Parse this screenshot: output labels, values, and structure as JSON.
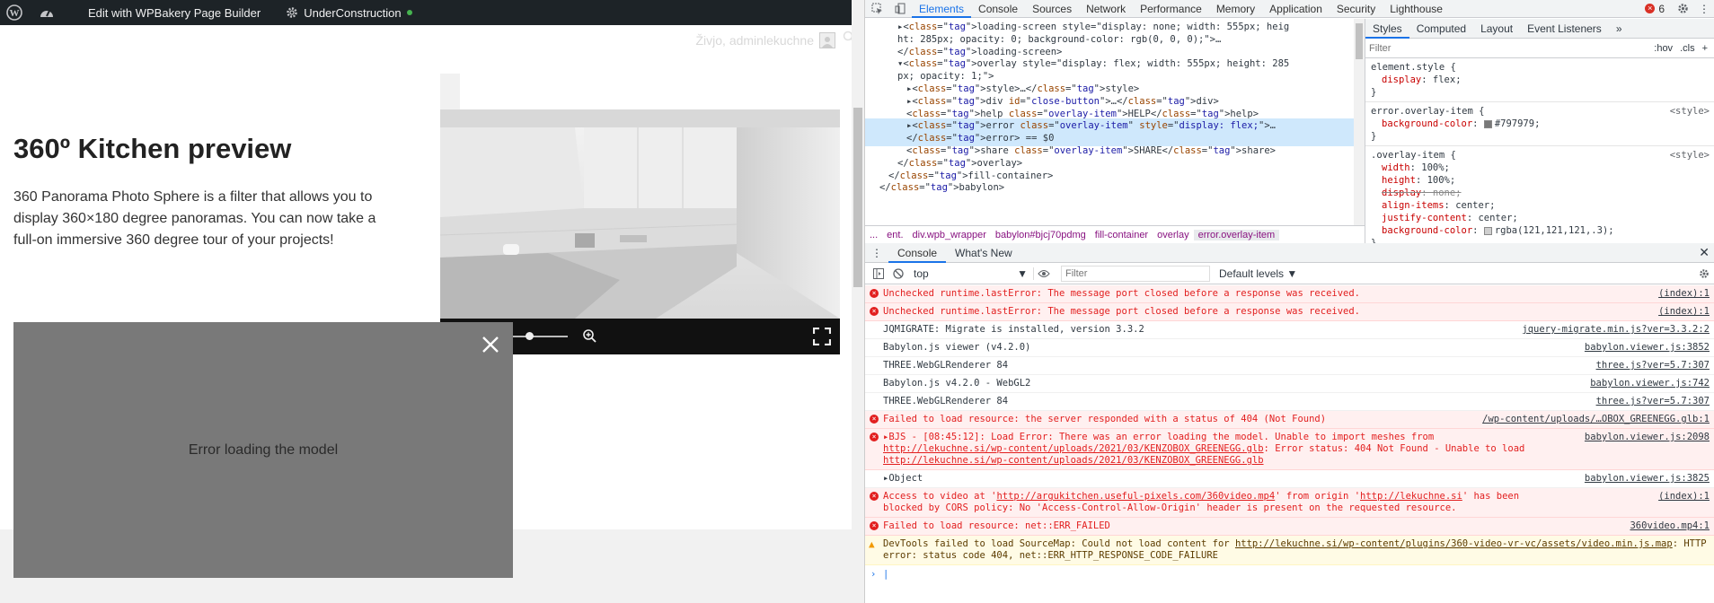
{
  "admin_bar": {
    "wpbakery_label": "Edit with WPBakery Page Builder",
    "site_status_label": "UnderConstruction",
    "status_color": "#46b450"
  },
  "header": {
    "user_greeting": "Živjo, adminlekuchne"
  },
  "hero": {
    "title": "360º Kitchen preview",
    "description": "360 Panorama Photo Sphere is a filter that allows you to display 360×180 degree panoramas. You can now take a full-on immersive 360 degree tour of your projects!"
  },
  "viewer": {
    "overlay_color": "#797979",
    "error_text": "Error loading the model"
  },
  "devtools": {
    "tabs": [
      "Elements",
      "Console",
      "Sources",
      "Network",
      "Performance",
      "Memory",
      "Application",
      "Security",
      "Lighthouse"
    ],
    "error_count": "6",
    "dom_lines": [
      {
        "indent": 1,
        "html": "▸&lt;loading-screen style=\"display: none; width: 555px; heig"
      },
      {
        "indent": 1,
        "html": "ht: 285px; opacity: 0; background-color: rgb(0, 0, 0);\"&gt;…"
      },
      {
        "indent": 1,
        "html": "&lt;/loading-screen&gt;"
      },
      {
        "indent": 1,
        "html": "▾&lt;overlay style=\"display: flex; width: 555px; height: 285"
      },
      {
        "indent": 1,
        "html": "px; opacity: 1;\"&gt;"
      },
      {
        "indent": 2,
        "html": "▸&lt;style&gt;…&lt;/style&gt;"
      },
      {
        "indent": 2,
        "html": "▸&lt;div id=\"close-button\"&gt;…&lt;/div&gt;"
      },
      {
        "indent": 2,
        "html": "&lt;help class=\"overlay-item\"&gt;HELP&lt;/help&gt;"
      },
      {
        "indent": 2,
        "html": "▸&lt;error class=\"overlay-item\" style=\"display: flex;\"&gt;…",
        "selected": true
      },
      {
        "indent": 2,
        "html": "&lt;/error&gt; == $0",
        "selected": true
      },
      {
        "indent": 2,
        "html": "&lt;share class=\"overlay-item\"&gt;SHARE&lt;/share&gt;"
      },
      {
        "indent": 1,
        "html": "&lt;/overlay&gt;"
      },
      {
        "indent": 0,
        "html": "&lt;/fill-container&gt;"
      },
      {
        "indent": -1,
        "html": "&lt;/babylon&gt;"
      }
    ],
    "breadcrumbs": [
      "...",
      "ent.",
      "div.wpb_wrapper",
      "babylon#bjcj70pdmg",
      "fill-container",
      "overlay",
      "error.overlay-item"
    ],
    "styles_tabs": [
      "Styles",
      "Computed",
      "Layout",
      "Event Listeners",
      "»"
    ],
    "styles_filter_placeholder": "Filter",
    "styles_buttons": [
      ":hov",
      ".cls",
      "+"
    ],
    "rules": [
      {
        "selector": "element.style {",
        "source": "",
        "props": [
          {
            "name": "display",
            "value": "flex;"
          }
        ]
      },
      {
        "selector": "error.overlay-item {",
        "source": "<style>",
        "props": [
          {
            "name": "background-color",
            "value": "#797979;",
            "swatch": "#797979"
          }
        ]
      },
      {
        "selector": ".overlay-item {",
        "source": "<style>",
        "props": [
          {
            "name": "width",
            "value": "100%;"
          },
          {
            "name": "height",
            "value": "100%;"
          },
          {
            "name": "display",
            "value": "none;",
            "struck": true
          },
          {
            "name": "align-items",
            "value": "center;"
          },
          {
            "name": "justify-content",
            "value": "center;"
          },
          {
            "name": "background-color",
            "value": "rgba(121,121,121,.3);",
            "swatch": "#cfcfcf"
          }
        ]
      }
    ],
    "drawer_tabs": [
      "Console",
      "What's New"
    ],
    "context": "top",
    "console_filter_placeholder": "Filter",
    "levels_label": "Default levels ▼",
    "messages": [
      {
        "level": "error",
        "text": "Unchecked runtime.lastError: The message port closed before a response was received.",
        "source": "(index):1"
      },
      {
        "level": "error",
        "text": "Unchecked runtime.lastError: The message port closed before a response was received.",
        "source": "(index):1"
      },
      {
        "level": "info",
        "text": "JQMIGRATE: Migrate is installed, version 3.3.2",
        "source": "jquery-migrate.min.js?ver=3.3.2:2"
      },
      {
        "level": "info",
        "text": "Babylon.js viewer (v4.2.0)",
        "source": "babylon.viewer.js:3852"
      },
      {
        "level": "info",
        "text": "THREE.WebGLRenderer 84",
        "source": "three.js?ver=5.7:307"
      },
      {
        "level": "info",
        "text": "Babylon.js v4.2.0 - WebGL2",
        "source": "babylon.viewer.js:742"
      },
      {
        "level": "info",
        "text": "THREE.WebGLRenderer 84",
        "source": "three.js?ver=5.7:307"
      },
      {
        "level": "error",
        "text": "Failed to load resource: the server responded with a status of 404 (Not Found)",
        "source": "/wp-content/uploads/…OBOX_GREENEGG.glb:1"
      },
      {
        "level": "error",
        "text": "▸BJS - [08:45:12]: Load Error: There was an error loading the model. Unable to import meshes from http://lekuchne.si/wp-content/uploads/2021/03/KENZOBOX_GREENEGG.glb: Error status: 404 Not Found - Unable to load http://lekuchne.si/wp-content/uploads/2021/03/KENZOBOX_GREENEGG.glb",
        "source": "babylon.viewer.js:2098"
      },
      {
        "level": "info",
        "text": "▸Object",
        "source": "babylon.viewer.js:3825"
      },
      {
        "level": "error",
        "text": "Access to video at 'http://argukitchen.useful-pixels.com/360video.mp4' from origin 'http://lekuchne.si' has been blocked by CORS policy: No 'Access-Control-Allow-Origin' header is present on the requested resource.",
        "source": "(index):1"
      },
      {
        "level": "error",
        "text": "Failed to load resource: net::ERR_FAILED",
        "source": "360video.mp4:1"
      },
      {
        "level": "warn",
        "text": "DevTools failed to load SourceMap: Could not load content for http://lekuchne.si/wp-content/plugins/360-video-vr-vc/assets/video.min.js.map: HTTP error: status code 404, net::ERR_HTTP_RESPONSE_CODE_FAILURE",
        "source": ""
      }
    ]
  }
}
